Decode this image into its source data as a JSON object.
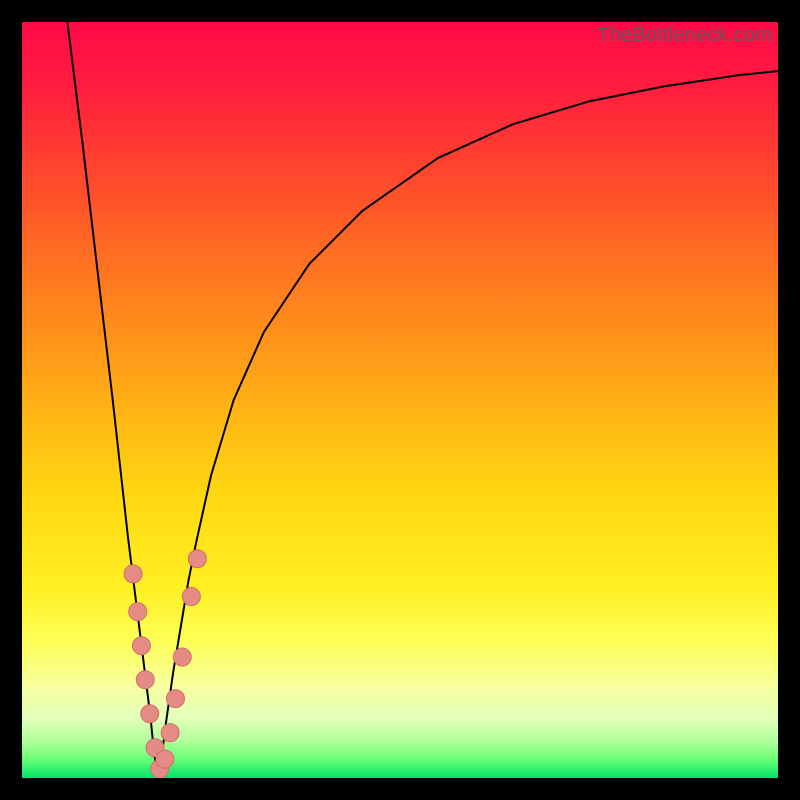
{
  "watermark": "TheBottleneck.com",
  "colors": {
    "frame": "#000000",
    "curve": "#000000",
    "marker_fill": "#e58b86",
    "marker_stroke": "#d36d68"
  },
  "chart_data": {
    "type": "line",
    "title": "",
    "xlabel": "",
    "ylabel": "",
    "xlim": [
      0,
      100
    ],
    "ylim": [
      0,
      100
    ],
    "note": "V-shaped bottleneck curve. x ~ relative component performance (0-100). y ~ bottleneck percentage (0 = no bottleneck at bottom/green, 100 = full bottleneck at top/red). Minimum (optimal match) occurs near x≈18.",
    "series": [
      {
        "name": "bottleneck-curve",
        "x": [
          6,
          8,
          10,
          12,
          14,
          15,
          16,
          17,
          17.5,
          18,
          18.5,
          19,
          20,
          21,
          22,
          23,
          25,
          28,
          32,
          38,
          45,
          55,
          65,
          75,
          85,
          95,
          100
        ],
        "y": [
          100,
          84,
          67,
          50,
          32,
          24,
          16,
          8,
          3,
          0.5,
          3,
          7,
          14,
          20,
          26,
          31,
          40,
          50,
          59,
          68,
          75,
          82,
          86.5,
          89.5,
          91.5,
          93,
          93.5
        ]
      }
    ],
    "markers": {
      "name": "highlighted-points",
      "note": "Salmon-colored sample dots clustered near the curve minimum.",
      "points": [
        {
          "x": 14.7,
          "y": 27
        },
        {
          "x": 15.3,
          "y": 22
        },
        {
          "x": 15.8,
          "y": 17.5
        },
        {
          "x": 16.3,
          "y": 13
        },
        {
          "x": 16.9,
          "y": 8.5
        },
        {
          "x": 17.6,
          "y": 4
        },
        {
          "x": 18.2,
          "y": 1.2
        },
        {
          "x": 18.9,
          "y": 2.5
        },
        {
          "x": 19.6,
          "y": 6
        },
        {
          "x": 20.3,
          "y": 10.5
        },
        {
          "x": 21.2,
          "y": 16
        },
        {
          "x": 22.4,
          "y": 24
        },
        {
          "x": 23.2,
          "y": 29
        }
      ]
    }
  }
}
